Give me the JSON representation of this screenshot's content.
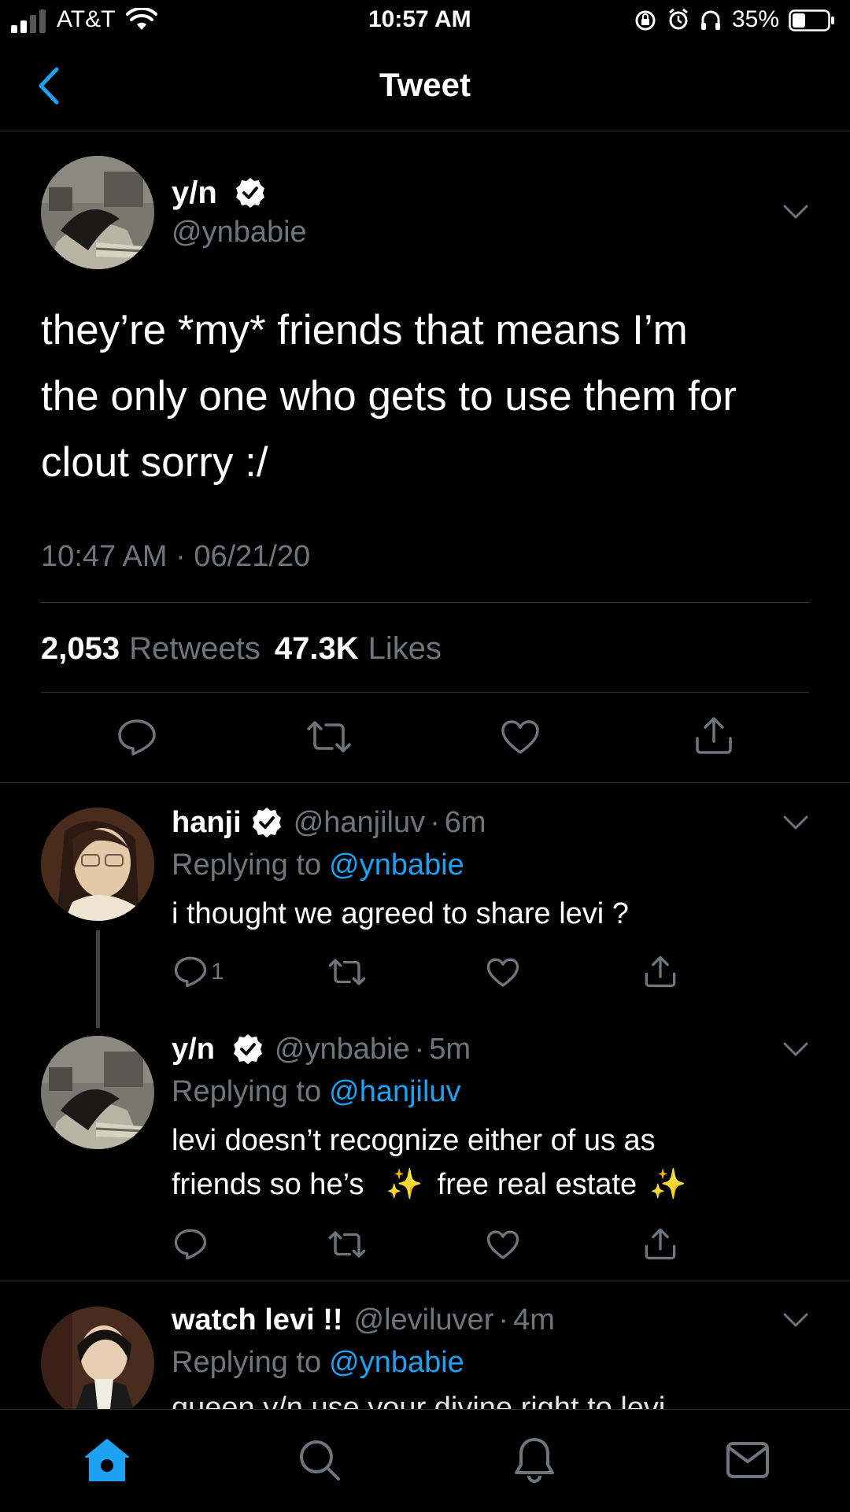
{
  "status_bar": {
    "carrier": "AT&T",
    "time": "10:57 AM",
    "battery": "35%"
  },
  "nav": {
    "title": "Tweet",
    "back_icon": "chevron-left-icon"
  },
  "main_tweet": {
    "name": "y/n",
    "handle": "@ynbabie",
    "text_lines": [
      "they’re *my* friends that means I’m",
      "the only one who gets to use them for",
      "clout sorry :/"
    ],
    "timestamp": "10:47 AM · 06/21/20",
    "retweets_count": "2,053",
    "retweets_label": "Retweets",
    "likes_count": "47.3K",
    "likes_label": "Likes"
  },
  "replies": [
    {
      "name": "hanji",
      "handle": "@hanjiluv",
      "time": "6m",
      "replying_prefix": "Replying to",
      "replying_to": "@ynbabie",
      "text_lines": [
        "i thought we agreed to share levi ?"
      ],
      "reply_count": "1"
    },
    {
      "name": "y/n",
      "handle": "@ynbabie",
      "time": "5m",
      "replying_prefix": "Replying to",
      "replying_to": "@hanjiluv",
      "text_line1": "levi doesn’t recognize either of us as",
      "text_line2a": "friends so he’s",
      "sparkle": "✨",
      "text_line2b": "free real estate",
      "reply_count": ""
    },
    {
      "name": "watch levi !!",
      "handle": "@leviluver",
      "time": "4m",
      "replying_prefix": "Replying to",
      "replying_to": "@ynbabie",
      "text_partial": "queen y/n use your divine right to levi"
    }
  ],
  "tabbar": {
    "items": [
      "home-icon",
      "search-icon",
      "notifications-icon",
      "messages-icon"
    ]
  },
  "colors": {
    "accent": "#1da1f2",
    "background": "#000000",
    "secondary_text": "#6e767d",
    "separator": "#2f3336"
  }
}
